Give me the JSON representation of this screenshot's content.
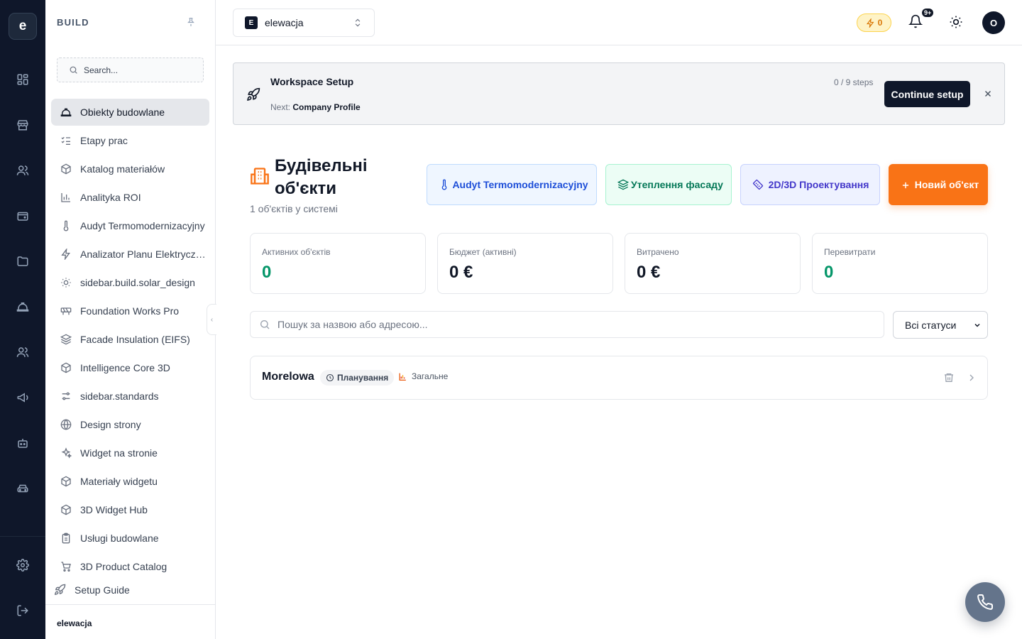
{
  "rail": {
    "logo": "e",
    "items": [
      "grid-icon",
      "store-icon",
      "users-icon",
      "wallet-icon",
      "folder-icon",
      "hardhat-icon",
      "team-icon",
      "megaphone-icon",
      "bot-icon",
      "car-icon"
    ],
    "bottom": [
      "settings-icon",
      "logout-icon"
    ]
  },
  "sidebar": {
    "title": "BUILD",
    "search_placeholder": "Search...",
    "items": [
      {
        "label": "Obiekty budowlane",
        "icon": "hardhat-icon",
        "active": true
      },
      {
        "label": "Etapy prac",
        "icon": "list-checks-icon"
      },
      {
        "label": "Katalog materiałów",
        "icon": "box-icon"
      },
      {
        "label": "Analityka ROI",
        "icon": "bar-chart-icon"
      },
      {
        "label": "Audyt Termomodernizacyjny",
        "icon": "thermometer-icon"
      },
      {
        "label": "Analizator Planu Elektrycznego",
        "icon": "zap-icon"
      },
      {
        "label": "sidebar.build.solar_design",
        "icon": "sun-icon"
      },
      {
        "label": "Foundation Works Pro",
        "icon": "construction-icon"
      },
      {
        "label": "Facade Insulation (EIFS)",
        "icon": "layers-icon"
      },
      {
        "label": "Intelligence Core 3D",
        "icon": "box-icon"
      },
      {
        "label": "sidebar.standards",
        "icon": "sliders-icon"
      },
      {
        "label": "Design strony",
        "icon": "globe-icon"
      },
      {
        "label": "Widget na stronie",
        "icon": "sparkles-icon"
      },
      {
        "label": "Materiały widgetu",
        "icon": "box-icon"
      },
      {
        "label": "3D Widget Hub",
        "icon": "box-icon"
      },
      {
        "label": "Usługi budowlane",
        "icon": "clipboard-icon"
      },
      {
        "label": "3D Product Catalog",
        "icon": "cart-icon"
      }
    ],
    "setup_guide": "Setup Guide",
    "footer": "elewacja"
  },
  "topbar": {
    "workspace_badge": "E",
    "workspace_name": "elewacja",
    "credits": "0",
    "notifications_badge": "9+",
    "avatar": "O"
  },
  "setup": {
    "title": "Workspace Setup",
    "next_label": "Next:",
    "next_value": "Company Profile",
    "steps": "0 / 9 steps",
    "button": "Continue setup"
  },
  "page": {
    "title": "Будівельні об'єкти",
    "subtitle": "1 об'єктів у системі",
    "actions": {
      "audyt": "Audyt Termomodernizacyjny",
      "facade": "Утеплення фасаду",
      "design": "2D/3D Проектування",
      "new": "Новий об'єкт"
    }
  },
  "stats": [
    {
      "label": "Активних об'єктів",
      "value": "0",
      "color": "#059669"
    },
    {
      "label": "Бюджет (активні)",
      "value": "0 €",
      "color": "#111827"
    },
    {
      "label": "Витрачено",
      "value": "0 €",
      "color": "#111827"
    },
    {
      "label": "Перевитрати",
      "value": "0",
      "color": "#059669"
    }
  ],
  "filters": {
    "search_placeholder": "Пошук за назвою або адресою...",
    "status_value": "Всі статуси"
  },
  "objects": [
    {
      "name": "Morelowa",
      "status": "Планування",
      "category": "Загальне"
    }
  ],
  "colors": {
    "accent": "#f97316",
    "dark": "#0f172a",
    "positive": "#059669"
  }
}
